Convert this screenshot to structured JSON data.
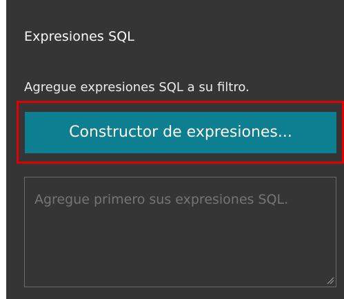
{
  "panel": {
    "title": "Expresiones SQL",
    "description": "Agregue expresiones SQL a su filtro.",
    "builder_button_label": "Constructor de expresiones...",
    "textarea_placeholder": "Agregue primero sus expresiones SQL."
  },
  "colors": {
    "panel_background": "#353535",
    "button_background": "#0e7f91",
    "highlight_border": "#e30000"
  },
  "icons": {
    "resize": "resize-grip-icon"
  }
}
